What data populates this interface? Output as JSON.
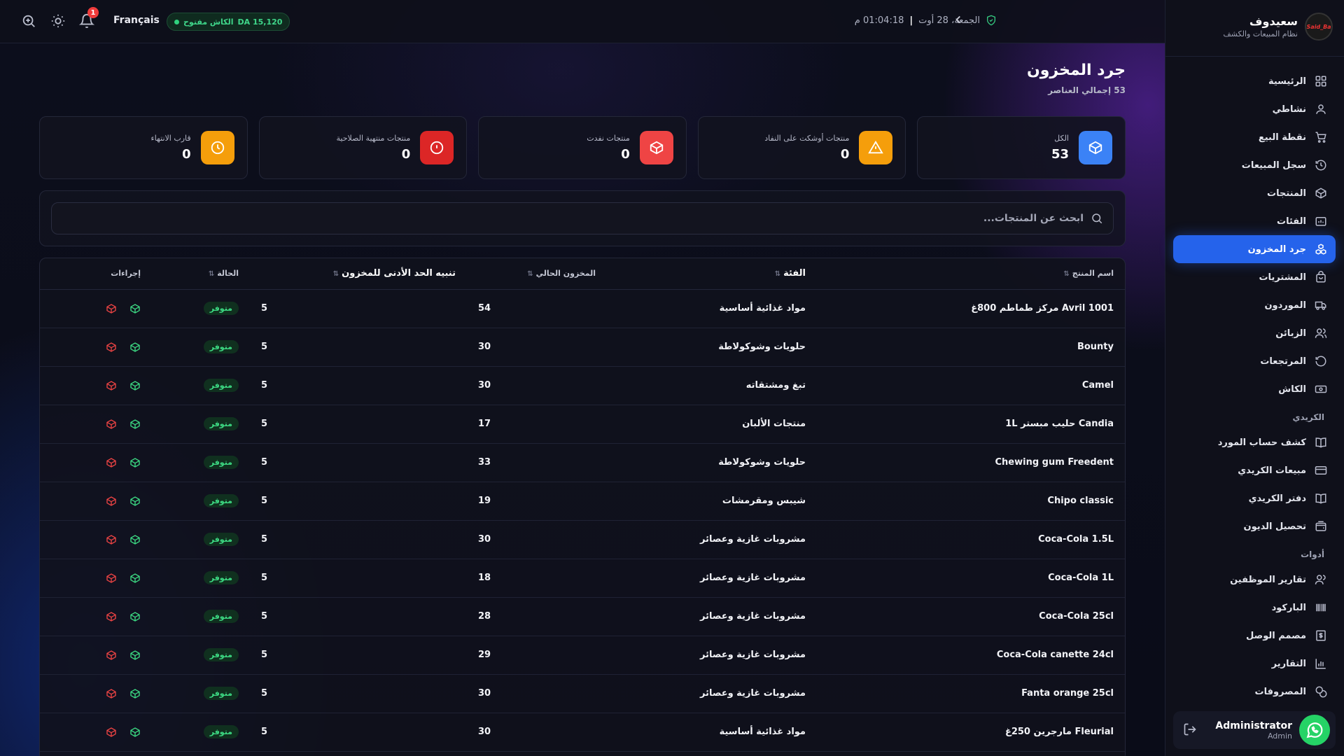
{
  "topbar": {
    "language": "Français",
    "cash_status": "الكاش مفتوح",
    "cash_amount": "DA 15,120",
    "date": "الجمعة، 28 أوت",
    "time": "01:04:18 م",
    "notification_count": "1"
  },
  "brand": {
    "title": "سعيدوف",
    "subtitle": "نظام المبيعات والكشف",
    "logo_text": "Said_Ba"
  },
  "nav": {
    "items": [
      {
        "label": "الرئيسية",
        "icon": "grid-icon"
      },
      {
        "label": "نشاطي",
        "icon": "user-icon"
      },
      {
        "label": "نقطة البيع",
        "icon": "cart-icon"
      },
      {
        "label": "سجل المبيعات",
        "icon": "history-icon"
      },
      {
        "label": "المنتجات",
        "icon": "box-icon"
      },
      {
        "label": "الفئات",
        "icon": "folder-icon"
      },
      {
        "label": "جرد المخزون",
        "icon": "boxes-icon"
      },
      {
        "label": "المشتريات",
        "icon": "bag-icon"
      },
      {
        "label": "الموردون",
        "icon": "truck-icon"
      },
      {
        "label": "الزبائن",
        "icon": "users-icon"
      },
      {
        "label": "المرتجعات",
        "icon": "return-icon"
      },
      {
        "label": "الكاش",
        "icon": "cash-icon"
      }
    ],
    "section_credit": "الكريدي",
    "credit_items": [
      {
        "label": "كشف حساب المورد",
        "icon": "book-icon"
      },
      {
        "label": "مبيعات الكريدي",
        "icon": "card-icon"
      },
      {
        "label": "دفتر الكريدي",
        "icon": "book-open-icon"
      },
      {
        "label": "تحصيل الديون",
        "icon": "wallet-icon"
      }
    ],
    "section_tools": "أدوات",
    "tool_items": [
      {
        "label": "تقارير الموظفين",
        "icon": "team-icon"
      },
      {
        "label": "الباركود",
        "icon": "barcode-icon"
      },
      {
        "label": "مصمم الوصل",
        "icon": "receipt-icon"
      },
      {
        "label": "التقارير",
        "icon": "chart-icon"
      },
      {
        "label": "المصروفات",
        "icon": "coins-icon"
      }
    ]
  },
  "user": {
    "name": "Administrator",
    "role": "Admin"
  },
  "page": {
    "title": "جرد المخزون",
    "subtitle": "53 إجمالي العناصر"
  },
  "stats": [
    {
      "label": "الكل",
      "value": "53",
      "color": "#3b82f6"
    },
    {
      "label": "منتجات أوشكت على النفاد",
      "value": "0",
      "color": "#f59e0b"
    },
    {
      "label": "منتجات نفدت",
      "value": "0",
      "color": "#ef4444"
    },
    {
      "label": "منتجات منتهية الصلاحية",
      "value": "0",
      "color": "#dc2626"
    },
    {
      "label": "قارب الانتهاء",
      "value": "0",
      "color": "#f59e0b"
    }
  ],
  "search": {
    "placeholder": "ابحث عن المنتجات..."
  },
  "table": {
    "headers": {
      "name": "اسم المنتج",
      "category": "الفئة",
      "stock": "المخزون الحالي",
      "min_alert": "تنبيه الحد الأدنى للمخزون",
      "status": "الحالة",
      "actions": "إجراءات"
    },
    "rows": [
      {
        "name": "Avril 1001 مركز طماطم 800غ",
        "category": "مواد غذائية أساسية",
        "stock": "54",
        "min": "5",
        "status": "متوفر"
      },
      {
        "name": "Bounty",
        "category": "حلويات وشوكولاطة",
        "stock": "30",
        "min": "5",
        "status": "متوفر"
      },
      {
        "name": "Camel",
        "category": "تبغ ومشتقاته",
        "stock": "30",
        "min": "5",
        "status": "متوفر"
      },
      {
        "name": "Candia حليب مبستر 1L",
        "category": "منتجات الألبان",
        "stock": "17",
        "min": "5",
        "status": "متوفر"
      },
      {
        "name": "Chewing gum Freedent",
        "category": "حلويات وشوكولاطة",
        "stock": "33",
        "min": "5",
        "status": "متوفر"
      },
      {
        "name": "Chipo classic",
        "category": "شيبس ومقرمشات",
        "stock": "19",
        "min": "5",
        "status": "متوفر"
      },
      {
        "name": "Coca-Cola 1.5L",
        "category": "مشروبات غازية وعصائر",
        "stock": "30",
        "min": "5",
        "status": "متوفر"
      },
      {
        "name": "Coca-Cola 1L",
        "category": "مشروبات غازية وعصائر",
        "stock": "18",
        "min": "5",
        "status": "متوفر"
      },
      {
        "name": "Coca-Cola 25cl",
        "category": "مشروبات غازية وعصائر",
        "stock": "28",
        "min": "5",
        "status": "متوفر"
      },
      {
        "name": "Coca-Cola canette 24cl",
        "category": "مشروبات غازية وعصائر",
        "stock": "29",
        "min": "5",
        "status": "متوفر"
      },
      {
        "name": "Fanta orange 25cl",
        "category": "مشروبات غازية وعصائر",
        "stock": "30",
        "min": "5",
        "status": "متوفر"
      },
      {
        "name": "Fleurial مارجرين 250غ",
        "category": "مواد غذائية أساسية",
        "stock": "30",
        "min": "5",
        "status": "متوفر"
      }
    ]
  }
}
